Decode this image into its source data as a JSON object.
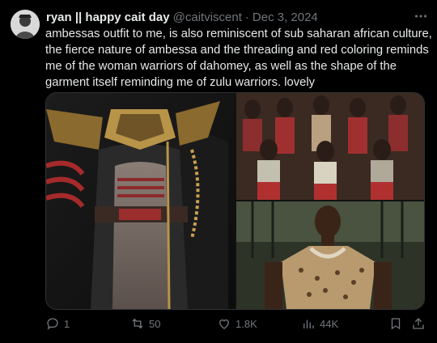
{
  "tweet": {
    "display_name": "ryan || happy cait day",
    "handle": "@caitviscent",
    "separator": "·",
    "date": "Dec 3, 2024",
    "text": "ambessas outfit to me, is also reminiscent of sub saharan african culture, the fierce nature of ambessa and the threading and red coloring reminds me of the woman warriors of dahomey, as well as the shape of the garment itself reminding me of zulu warriors. lovely"
  },
  "media": {
    "left_image": "character-outfit-render",
    "top_right_image": "dahomey-warriors-photo",
    "bottom_right_image": "zulu-warrior-photo"
  },
  "actions": {
    "replies": "1",
    "reposts": "50",
    "likes": "1.8K",
    "views": "44K"
  },
  "icons": [
    "more-icon",
    "reply-icon",
    "repost-icon",
    "like-icon",
    "views-icon",
    "bookmark-icon",
    "share-icon"
  ],
  "colors": {
    "background": "#000000",
    "text": "#e7e9ea",
    "muted": "#71767b"
  }
}
